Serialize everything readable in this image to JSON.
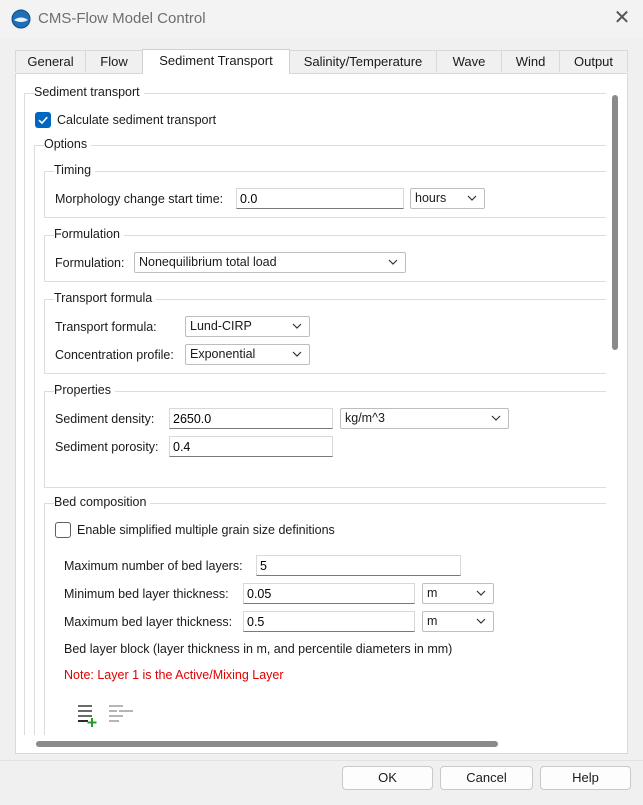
{
  "window": {
    "title": "CMS-Flow Model Control",
    "close_icon": "close-icon"
  },
  "tabs": [
    {
      "label": "General",
      "active": false
    },
    {
      "label": "Flow",
      "active": false
    },
    {
      "label": "Sediment Transport",
      "active": true
    },
    {
      "label": "Salinity/Temperature",
      "active": false
    },
    {
      "label": "Wave",
      "active": false
    },
    {
      "label": "Wind",
      "active": false
    },
    {
      "label": "Output",
      "active": false
    }
  ],
  "sediment": {
    "section_title": "Sediment transport",
    "calculate_label": "Calculate sediment transport",
    "calculate_checked": true,
    "options_title": "Options",
    "timing": {
      "title": "Timing",
      "start_label": "Morphology change start time:",
      "start_value": "0.0",
      "start_unit": "hours"
    },
    "formulation": {
      "title": "Formulation",
      "label": "Formulation:",
      "value": "Nonequilibrium total load"
    },
    "transport": {
      "title": "Transport formula",
      "formula_label": "Transport formula:",
      "formula_value": "Lund-CIRP",
      "profile_label": "Concentration profile:",
      "profile_value": "Exponential"
    },
    "properties": {
      "title": "Properties",
      "density_label": "Sediment density:",
      "density_value": "2650.0",
      "density_unit": "kg/m^3",
      "porosity_label": "Sediment porosity:",
      "porosity_value": "0.4"
    },
    "bed": {
      "title": "Bed composition",
      "multi_grain_label": "Enable simplified multiple grain size definitions",
      "multi_grain_checked": false,
      "max_layers_label": "Maximum number of bed layers:",
      "max_layers_value": "5",
      "min_thick_label": "Minimum bed layer thickness:",
      "min_thick_value": "0.05",
      "min_thick_unit": "m",
      "max_thick_label": "Maximum bed layer thickness:",
      "max_thick_value": "0.5",
      "max_thick_unit": "m",
      "block_label": "Bed layer block (layer thickness in m, and percentile diameters in mm)",
      "note": "Note: Layer 1 is the Active/Mixing Layer"
    }
  },
  "buttons": {
    "ok": "OK",
    "cancel": "Cancel",
    "help": "Help"
  },
  "colors": {
    "accent": "#0067c0",
    "note": "#e00000",
    "add_icon": "#22a022"
  }
}
